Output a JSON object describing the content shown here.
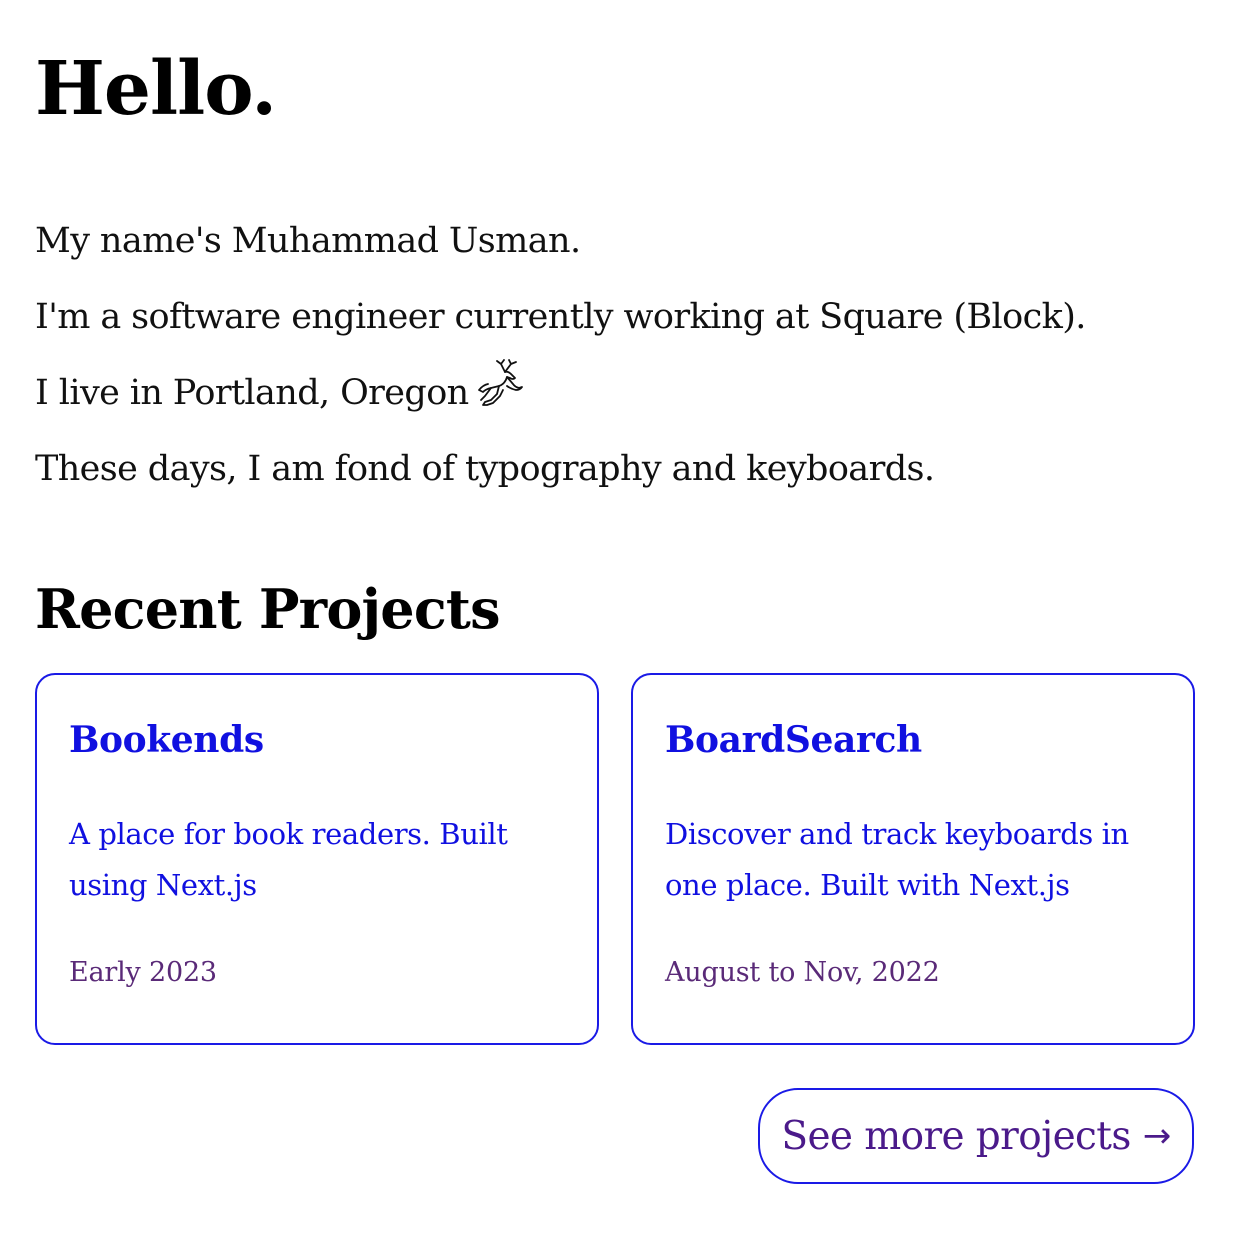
{
  "header": {
    "greeting": "Hello."
  },
  "intro": {
    "lines": [
      "My name's Muhammad Usman.",
      "I'm a software engineer currently working at Square (Block).",
      "I live in Portland, Oregon",
      "These days, I am fond of typography and keyboards."
    ],
    "location_icon": "deer-icon"
  },
  "projects": {
    "heading": "Recent Projects",
    "items": [
      {
        "title": "Bookends",
        "description": "A place for book readers. Built using Next.js",
        "date": "Early 2023"
      },
      {
        "title": "BoardSearch",
        "description": "Discover and track keyboards in one place. Built with Next.js",
        "date": "August to Nov, 2022"
      }
    ],
    "more_label": "See more projects",
    "more_icon": "arrow-right-icon"
  },
  "colors": {
    "link": "#1010e0",
    "border": "#1a1ae6",
    "date": "#5a2a78",
    "button_text": "#4b1a8a",
    "text": "#111111"
  }
}
